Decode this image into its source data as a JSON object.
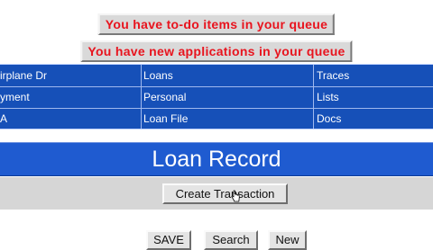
{
  "alerts": {
    "todo": "You have to-do items in your queue",
    "applications": "You have new applications in your queue"
  },
  "nav": {
    "rows": [
      [
        "irplane Dr",
        "Loans",
        "Traces"
      ],
      [
        "yment",
        "Personal",
        "Lists"
      ],
      [
        "A",
        "Loan File",
        "Docs"
      ]
    ]
  },
  "header": {
    "title": "Loan Record"
  },
  "toolbar": {
    "create_label": "Create Transaction"
  },
  "bottom": {
    "save_label": "SAVE",
    "search_label": "Search",
    "new_label": "New"
  },
  "colors": {
    "alert_text": "#e8141e",
    "nav_bg": "#1650b8",
    "header_bg": "#1f5bd0",
    "toolbar_bg": "#d6d6d6"
  },
  "icons": {
    "cursor": "hand-pointer-icon"
  }
}
